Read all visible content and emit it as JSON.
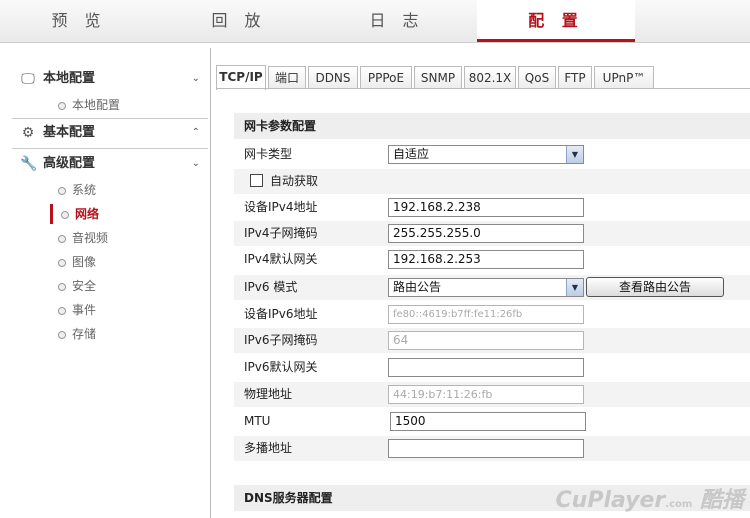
{
  "topnav": {
    "tabs": [
      {
        "label": "预 览"
      },
      {
        "label": "回 放"
      },
      {
        "label": "日 志"
      },
      {
        "label": "配 置"
      }
    ],
    "active_index": 3,
    "accent_color": "#b5121b"
  },
  "sidebar": {
    "groups": [
      {
        "label": "本地配置",
        "icon": "monitor-icon",
        "items": [
          "本地配置"
        ]
      },
      {
        "label": "基本配置",
        "icon": "gear-icon",
        "items": []
      },
      {
        "label": "高级配置",
        "icon": "wrench-icon",
        "items": [
          "系统",
          "网络",
          "音视频",
          "图像",
          "安全",
          "事件",
          "存储"
        ]
      }
    ],
    "active_item": "网络"
  },
  "subtabs": [
    "TCP/IP",
    "端口",
    "DDNS",
    "PPPoE",
    "SNMP",
    "802.1X",
    "QoS",
    "FTP",
    "UPnP™"
  ],
  "active_subtab": "TCP/IP",
  "nic_section": {
    "title": "网卡参数配置",
    "nic_type_label": "网卡类型",
    "nic_type_value": "自适应",
    "dhcp_label": "自动获取",
    "ipv4_addr_label": "设备IPv4地址",
    "ipv4_addr_value": "192.168.2.238",
    "ipv4_mask_label": "IPv4子网掩码",
    "ipv4_mask_value": "255.255.255.0",
    "ipv4_gw_label": "IPv4默认网关",
    "ipv4_gw_value": "192.168.2.253",
    "ipv6_mode_label": "IPv6 模式",
    "ipv6_mode_value": "路由公告",
    "view_route_button": "查看路由公告",
    "ipv6_addr_label": "设备IPv6地址",
    "ipv6_addr_value": "fe80::4619:b7ff:fe11:26fb",
    "ipv6_mask_label": "IPv6子网掩码",
    "ipv6_mask_value": "64",
    "ipv6_gw_label": "IPv6默认网关",
    "ipv6_gw_value": "",
    "mac_label": "物理地址",
    "mac_value": "44:19:b7:11:26:fb",
    "mtu_label": "MTU",
    "mtu_value": "1500",
    "multicast_label": "多播地址",
    "multicast_value": ""
  },
  "dns_section": {
    "title": "DNS服务器配置"
  },
  "watermark": {
    "text": "CuPlayer",
    "sub": ".com",
    "cn": "酷播"
  }
}
